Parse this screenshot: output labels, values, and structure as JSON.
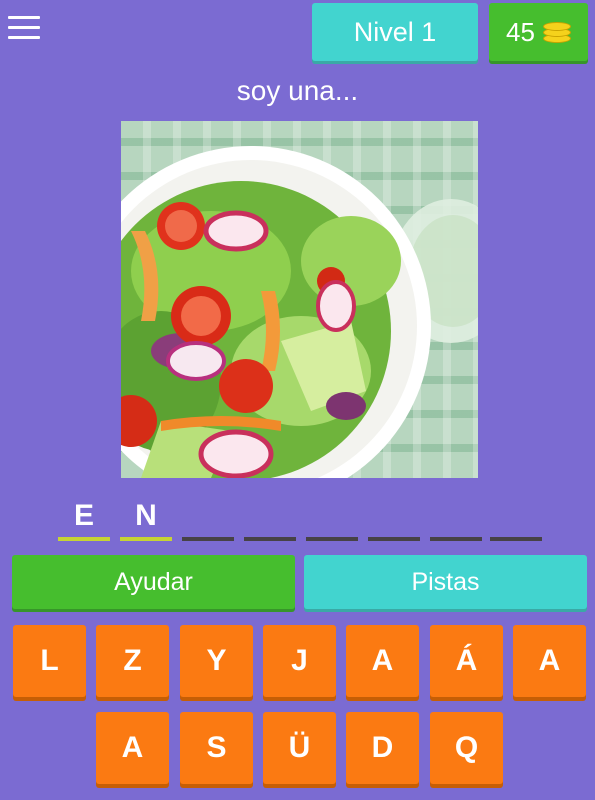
{
  "header": {
    "menu_icon": "hamburger-menu-icon",
    "level_label": "Nivel 1",
    "coins": "45",
    "coin_icon": "coin-stack-icon"
  },
  "question": "soy una...",
  "answer": {
    "letters": [
      "E",
      "N",
      "",
      "",
      "",
      "",
      "",
      ""
    ],
    "filled_color": "#c6d434",
    "empty_color": "#474246"
  },
  "buttons": {
    "help_label": "Ayudar",
    "hints_label": "Pistas"
  },
  "keyboard": {
    "row1": [
      "L",
      "Z",
      "Y",
      "J",
      "A",
      "Á",
      "A"
    ],
    "row2": [
      "A",
      "S",
      "Ü",
      "D",
      "Q"
    ]
  },
  "colors": {
    "background": "#7b6bd2",
    "level_badge": "#42d4cf",
    "coins_badge": "#46be2e",
    "help_button": "#46be2e",
    "hints_button": "#42d4cf",
    "key": "#fb7a12"
  }
}
